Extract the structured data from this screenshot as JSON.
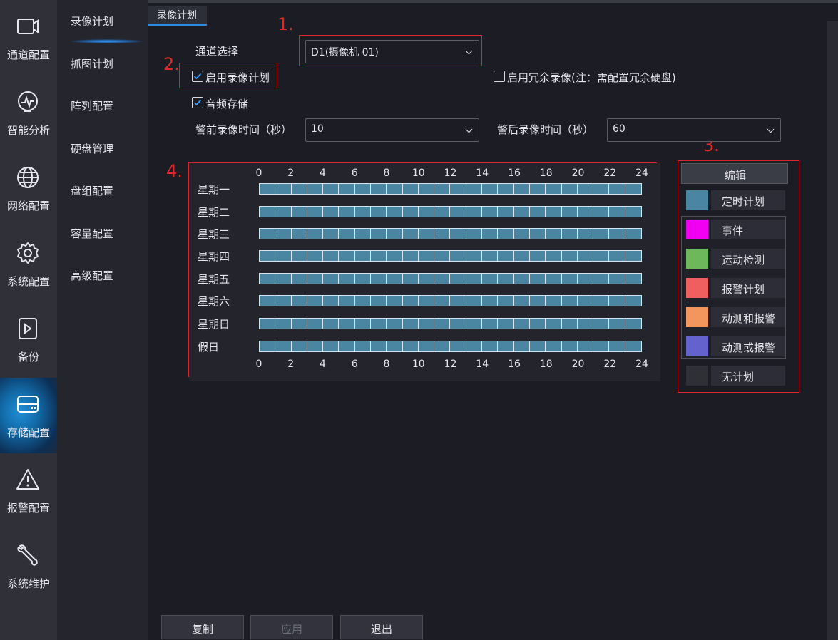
{
  "rail": [
    {
      "label": "通道配置",
      "icon": "camera-icon"
    },
    {
      "label": "智能分析",
      "icon": "analytics-icon"
    },
    {
      "label": "网络配置",
      "icon": "globe-icon"
    },
    {
      "label": "系统配置",
      "icon": "gear-icon"
    },
    {
      "label": "备份",
      "icon": "backup-icon"
    },
    {
      "label": "存储配置",
      "icon": "storage-icon",
      "active": true
    },
    {
      "label": "报警配置",
      "icon": "alarm-icon"
    },
    {
      "label": "系统维护",
      "icon": "wrench-icon"
    }
  ],
  "submenu": [
    "录像计划",
    "抓图计划",
    "阵列配置",
    "硬盘管理",
    "盘组配置",
    "容量配置",
    "高级配置"
  ],
  "tab": {
    "label": "录像计划"
  },
  "markers": {
    "m1": "1.",
    "m2": "2.",
    "m3": "3.",
    "m4": "4."
  },
  "form": {
    "channel_label": "通道选择",
    "channel_value": "D1(摄像机 01)",
    "enable_schedule_label": "启用录像计划",
    "enable_schedule_checked": true,
    "redundant_label": "启用冗余录像(注：需配置冗余硬盘)",
    "redundant_checked": false,
    "audio_label": "音频存储",
    "audio_checked": true,
    "pre_label": "警前录像时间（秒）",
    "pre_value": "10",
    "post_label": "警后录像时间（秒）",
    "post_value": "60"
  },
  "schedule": {
    "hours": [
      "0",
      "2",
      "4",
      "6",
      "8",
      "10",
      "12",
      "14",
      "16",
      "18",
      "20",
      "22",
      "24"
    ],
    "days": [
      "星期一",
      "星期二",
      "星期三",
      "星期四",
      "星期五",
      "星期六",
      "星期日",
      "假日"
    ],
    "segments_per_day": 24,
    "fill_type": "定时计划"
  },
  "legend": {
    "edit_label": "编辑",
    "items": [
      {
        "label": "定时计划",
        "color": "#4a86a2"
      },
      {
        "label": "事件",
        "color": "#f000f0"
      },
      {
        "label": "运动检测",
        "color": "#6cb85a"
      },
      {
        "label": "报警计划",
        "color": "#f05f5f"
      },
      {
        "label": "动测和报警",
        "color": "#f2965e"
      },
      {
        "label": "动测或报警",
        "color": "#6463cd"
      },
      {
        "label": "无计划",
        "color": "#2f3036"
      }
    ]
  },
  "buttons": {
    "copy": "复制",
    "apply": "应用",
    "exit": "退出"
  }
}
